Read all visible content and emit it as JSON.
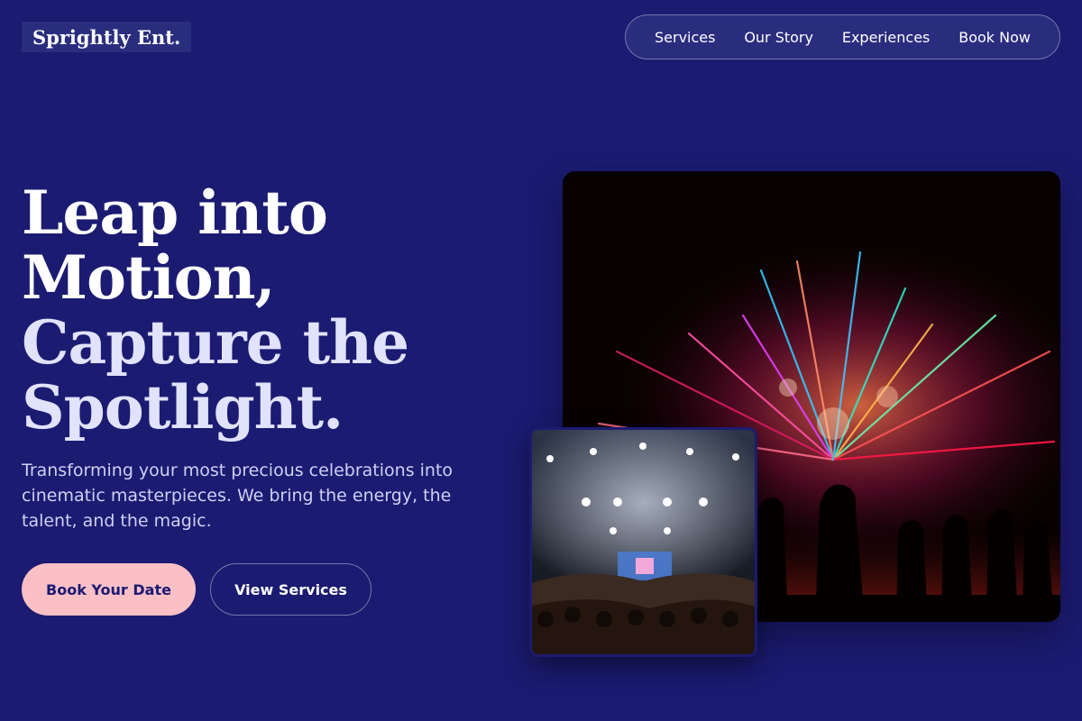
{
  "brand": {
    "name": "Sprightly Ent."
  },
  "nav": {
    "items": [
      "Services",
      "Our Story",
      "Experiences",
      "Book Now"
    ]
  },
  "hero": {
    "title_lines": [
      "Leap into",
      "Motion,",
      "Capture the",
      "Spotlight."
    ],
    "subtitle": "Transforming your most precious celebrations into cinematic masterpieces. We bring the energy, the talent, and the magic.",
    "primary_cta": "Book Your Date",
    "secondary_cta": "View Services"
  },
  "colors": {
    "background": "#1b1b72",
    "accent": "#fbbfc6",
    "nav_pill": "#2a2d7e"
  },
  "images": {
    "main": "fireworks-crowd-photo",
    "inset": "concert-stage-photo"
  }
}
